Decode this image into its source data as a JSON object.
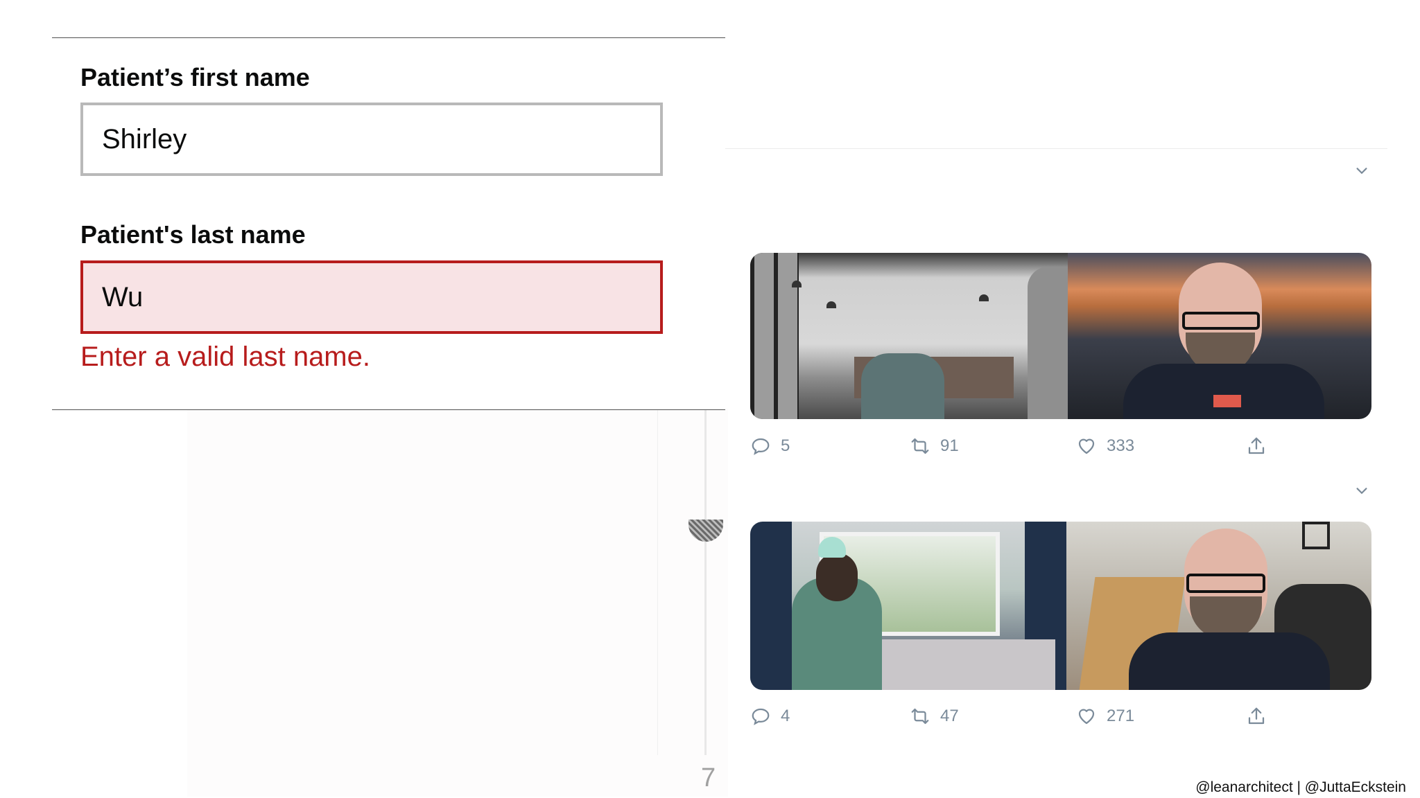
{
  "form": {
    "first_name": {
      "label": "Patient’s first name",
      "value": "Shirley"
    },
    "last_name": {
      "label": "Patient's last name",
      "value": "Wu",
      "error": "Enter a valid last name."
    }
  },
  "tweets": [
    {
      "replies": "5",
      "retweets": "91",
      "likes": "333"
    },
    {
      "replies": "4",
      "retweets": "47",
      "likes": "271"
    }
  ],
  "page_number": "7",
  "credit": "@leanarchitect | @JuttaEckstein",
  "colors": {
    "error": "#b71c1c",
    "error_bg": "#f8e3e5",
    "icon": "#7a8a99"
  }
}
